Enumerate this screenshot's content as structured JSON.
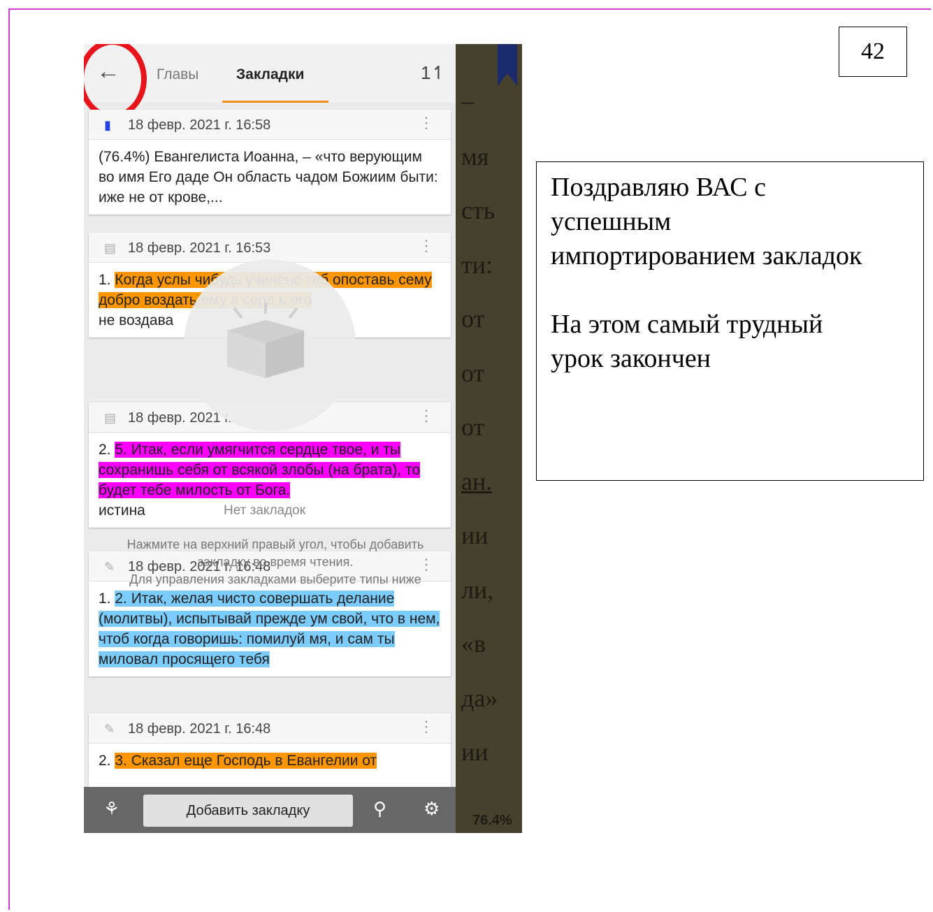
{
  "slide": {
    "page_number": "42",
    "note_lines": [
      "Поздравляю ВАС с",
      "успешным",
      "импортированием закладок"
    ],
    "note_lines2": [
      "На этом самый трудный",
      "урок закончен"
    ]
  },
  "app": {
    "tabs": [
      "Главы",
      "Закладки"
    ],
    "active_tab": "Закладки",
    "accent": "#f28c1b",
    "cards": [
      {
        "icon": "bookmark-icon",
        "date": "18 февр. 2021 г. 16:58",
        "text": "(76.4%) Евангелиста Иоанна, – «что верующим во имя Его даде Он область чадом Божиим быти: иже не от крове,..."
      },
      {
        "icon": "note-icon",
        "date": "18 февр. 2021 г. 16:53",
        "prefix": "1. ",
        "highlight": "Когда услы чибудь учинено теб опоставь сему добро воздать ему в серд ь его",
        "note": "не воздава"
      },
      {
        "icon": "note-icon",
        "date": "18 февр. 2021 г.",
        "prefix": "2. ",
        "highlight": "5. Итак, если умягчится сердце твое, и ты сохранишь себя от всякой злобы (на брата), то будет тебе милость от Бога.",
        "note": "истина"
      },
      {
        "icon": "pencil-icon",
        "date": "18 февр. 2021 г. 16:48",
        "prefix": "1. ",
        "highlight": "2. Итак, желая чисто совершать делание (молитвы), испытывай прежде ум свой, что в нем, чтоб когда говоришь: помилуй мя, и сам ты миловал просящего тебя"
      },
      {
        "icon": "pencil-icon",
        "date": "18 февр. 2021 г. 16:48",
        "prefix": "2. ",
        "highlight": "3. Сказал еще Господь в Евангелии от"
      }
    ],
    "empty": {
      "title": "Нет закладок",
      "hint1": "Нажмите на верхний правый угол, чтобы добавить",
      "hint2": "закладку во время чтения.",
      "hint3": "Для управления закладками выберите типы ниже"
    },
    "add_button": "Добавить закладку",
    "reader_words": [
      "–",
      "мя",
      "сть",
      "ти:",
      "от",
      "от",
      "от",
      "ан.",
      "ии",
      "ли,",
      "«в",
      "да»",
      "ии"
    ],
    "progress": "76.4%"
  }
}
